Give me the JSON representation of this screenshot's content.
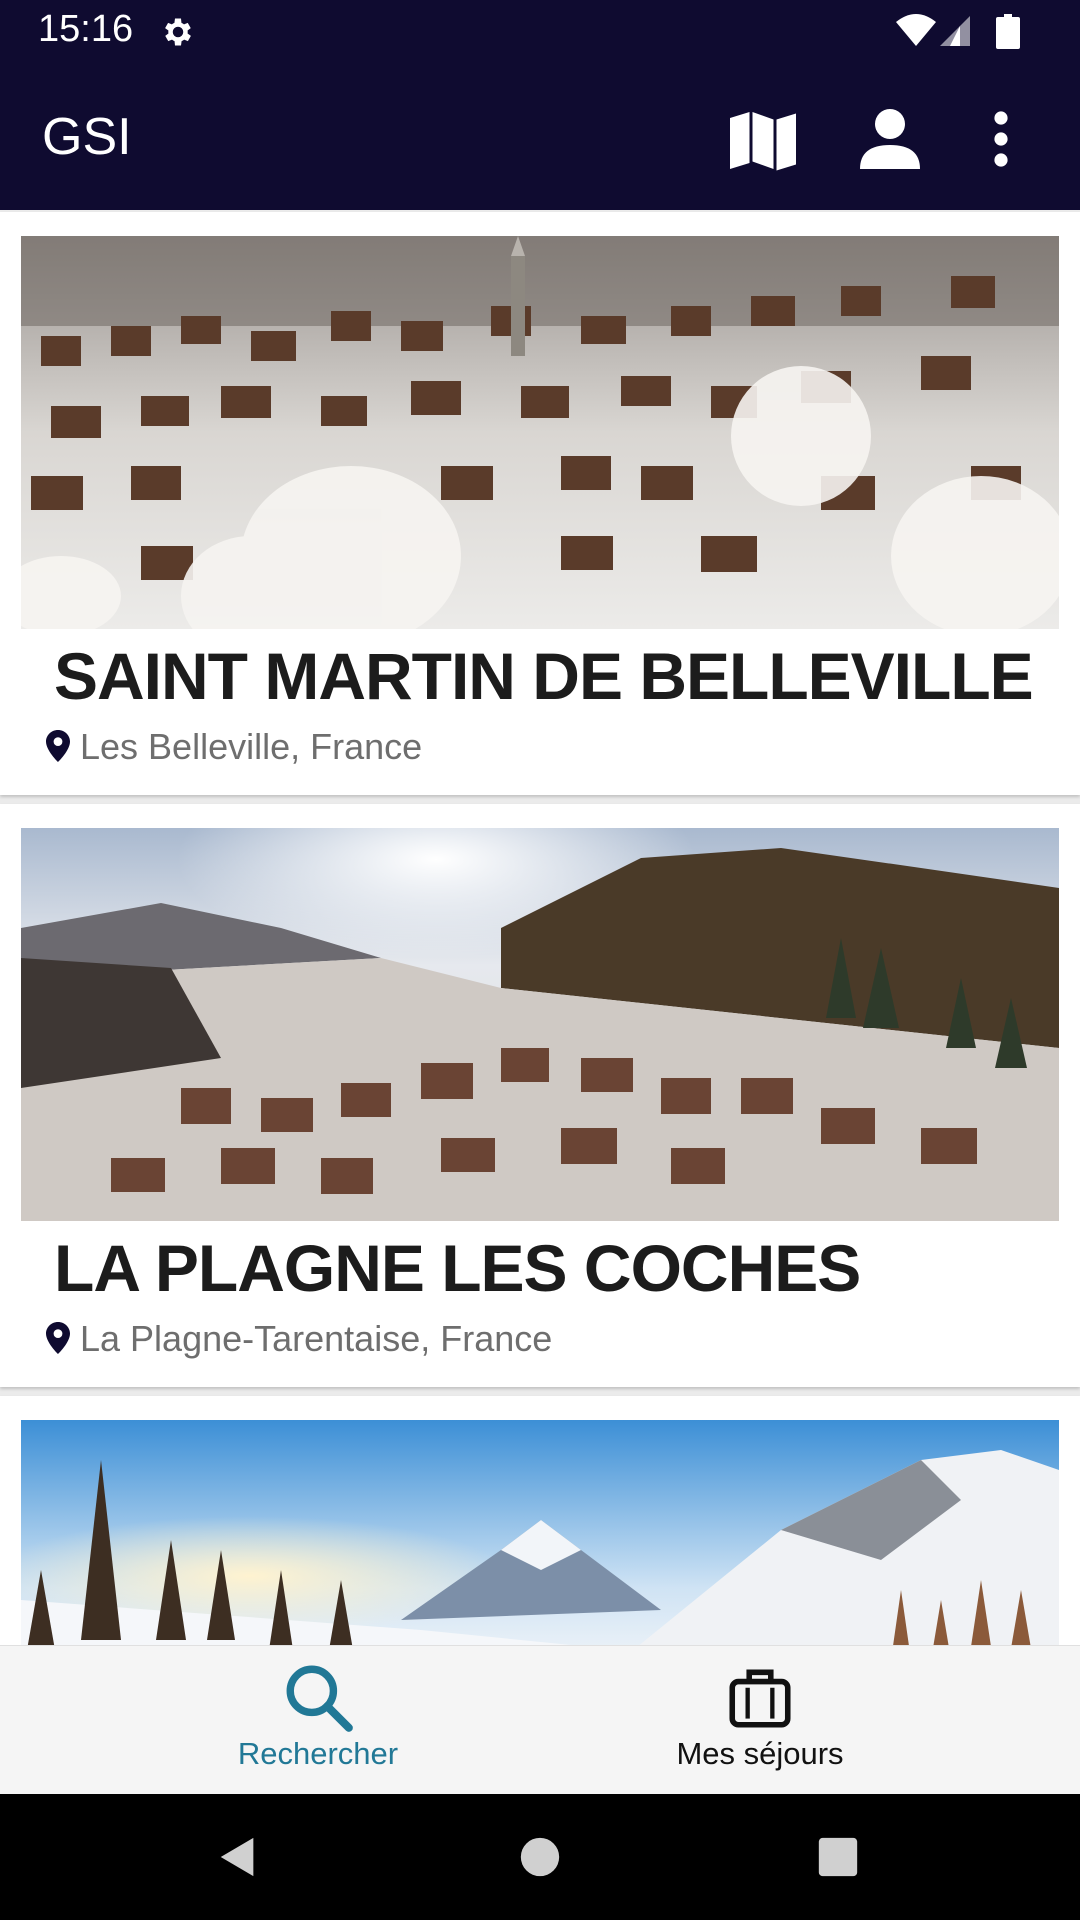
{
  "status_bar": {
    "time": "15:16",
    "icons": [
      "gear-icon",
      "wifi-icon",
      "signal-icon",
      "battery-icon"
    ]
  },
  "app_bar": {
    "title": "GSI",
    "actions": [
      "map-icon",
      "account-icon",
      "more-vert-icon"
    ]
  },
  "colors": {
    "primary": "#0f0b30",
    "accent": "#217896",
    "title_text": "#1c1c1c",
    "secondary_text": "#6e6e6e"
  },
  "destinations": [
    {
      "name": "SAINT MARTIN DE BELLEVILLE",
      "location": "Les Belleville, France",
      "image": "snowy-village-photo"
    },
    {
      "name": "LA PLAGNE LES COCHES",
      "location": "La Plagne-Tarentaise, France",
      "image": "mountain-resort-photo"
    },
    {
      "image": "snowy-peaks-photo"
    }
  ],
  "bottom_nav": {
    "items": [
      {
        "label": "Rechercher",
        "icon": "search-icon",
        "active": true
      },
      {
        "label": "Mes séjours",
        "icon": "briefcase-icon",
        "active": false
      }
    ]
  },
  "system_nav": [
    "back-icon",
    "home-icon",
    "recents-icon"
  ]
}
